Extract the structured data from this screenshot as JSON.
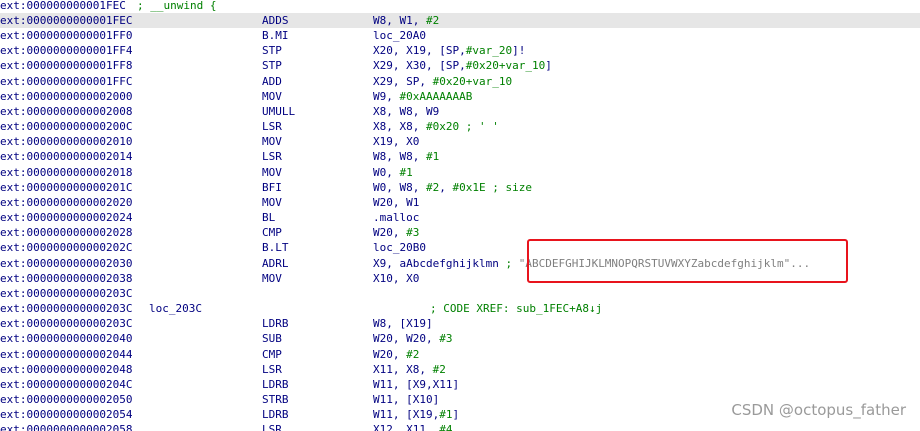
{
  "header": {
    "addr": "ext:000000000001FEC",
    "comment": "; __unwind {"
  },
  "rows": [
    {
      "addr": "ext:0000000000001FEC",
      "mn": "ADDS",
      "ops": [
        {
          "t": "W8, W1, "
        },
        {
          "t": "#2",
          "g": true
        }
      ],
      "selected": true
    },
    {
      "addr": "ext:0000000000001FF0",
      "mn": "B.MI",
      "ops": [
        {
          "t": "loc_20A0"
        }
      ]
    },
    {
      "addr": "ext:0000000000001FF4",
      "mn": "STP",
      "ops": [
        {
          "t": "X20, X19, [SP,"
        },
        {
          "t": "#var_20",
          "g": true
        },
        {
          "t": "]!"
        }
      ]
    },
    {
      "addr": "ext:0000000000001FF8",
      "mn": "STP",
      "ops": [
        {
          "t": "X29, X30, [SP,"
        },
        {
          "t": "#0x20+var_10",
          "g": true
        },
        {
          "t": "]"
        }
      ]
    },
    {
      "addr": "ext:0000000000001FFC",
      "mn": "ADD",
      "ops": [
        {
          "t": "X29, SP, "
        },
        {
          "t": "#0x20+var_10",
          "g": true
        }
      ]
    },
    {
      "addr": "ext:0000000000002000",
      "mn": "MOV",
      "ops": [
        {
          "t": "W9, "
        },
        {
          "t": "#0xAAAAAAAB",
          "g": true
        }
      ]
    },
    {
      "addr": "ext:0000000000002008",
      "mn": "UMULL",
      "ops": [
        {
          "t": "X8, W8, W9"
        }
      ]
    },
    {
      "addr": "ext:000000000000200C",
      "mn": "LSR",
      "ops": [
        {
          "t": "X8, X8, "
        },
        {
          "t": "#0x20",
          "g": true
        }
      ],
      "comment": "; ' '"
    },
    {
      "addr": "ext:0000000000002010",
      "mn": "MOV",
      "ops": [
        {
          "t": "X19, X0"
        }
      ]
    },
    {
      "addr": "ext:0000000000002014",
      "mn": "LSR",
      "ops": [
        {
          "t": "W8, W8, "
        },
        {
          "t": "#1",
          "g": true
        }
      ]
    },
    {
      "addr": "ext:0000000000002018",
      "mn": "MOV",
      "ops": [
        {
          "t": "W0, "
        },
        {
          "t": "#1",
          "g": true
        }
      ]
    },
    {
      "addr": "ext:000000000000201C",
      "mn": "BFI",
      "ops": [
        {
          "t": "W0, W8, "
        },
        {
          "t": "#2",
          "g": true
        },
        {
          "t": ", "
        },
        {
          "t": "#0x1E",
          "g": true
        }
      ],
      "comment": "; size"
    },
    {
      "addr": "ext:0000000000002020",
      "mn": "MOV",
      "ops": [
        {
          "t": "W20, W1"
        }
      ]
    },
    {
      "addr": "ext:0000000000002024",
      "mn": "BL",
      "ops": [
        {
          "t": ".malloc"
        }
      ]
    },
    {
      "addr": "ext:0000000000002028",
      "mn": "CMP",
      "ops": [
        {
          "t": "W20, "
        },
        {
          "t": "#3",
          "g": true
        }
      ]
    },
    {
      "addr": "ext:000000000000202C",
      "mn": "B.LT",
      "ops": [
        {
          "t": "loc_20B0"
        }
      ]
    },
    {
      "addr": "ext:0000000000002030",
      "mn": "ADRL",
      "ops": [
        {
          "t": "X9, aAbcdefghijklmn"
        }
      ],
      "comment": ";",
      "str": "\"ABCDEFGHIJKLMNOPQRSTUVWXYZabcdefghijklm\"..."
    },
    {
      "addr": "ext:0000000000002038",
      "mn": "MOV",
      "ops": [
        {
          "t": "X10, X0"
        }
      ]
    },
    {
      "addr": "ext:000000000000203C"
    },
    {
      "addr": "ext:000000000000203C",
      "label": "loc_203C",
      "xref": "; CODE XREF: sub_1FEC+A8↓j"
    },
    {
      "addr": "ext:000000000000203C",
      "mn": "LDRB",
      "ops": [
        {
          "t": "W8, [X19]"
        }
      ]
    },
    {
      "addr": "ext:0000000000002040",
      "mn": "SUB",
      "ops": [
        {
          "t": "W20, W20, "
        },
        {
          "t": "#3",
          "g": true
        }
      ]
    },
    {
      "addr": "ext:0000000000002044",
      "mn": "CMP",
      "ops": [
        {
          "t": "W20, "
        },
        {
          "t": "#2",
          "g": true
        }
      ]
    },
    {
      "addr": "ext:0000000000002048",
      "mn": "LSR",
      "ops": [
        {
          "t": "X11, X8, "
        },
        {
          "t": "#2",
          "g": true
        }
      ]
    },
    {
      "addr": "ext:000000000000204C",
      "mn": "LDRB",
      "ops": [
        {
          "t": "W11, [X9,X11]"
        }
      ]
    },
    {
      "addr": "ext:0000000000002050",
      "mn": "STRB",
      "ops": [
        {
          "t": "W11, [X10]"
        }
      ]
    },
    {
      "addr": "ext:0000000000002054",
      "mn": "LDRB",
      "ops": [
        {
          "t": "W11, [X19,"
        },
        {
          "t": "#1",
          "g": true
        },
        {
          "t": "]"
        }
      ]
    },
    {
      "addr": "ext:0000000000002058",
      "mn": "LSR",
      "ops": [
        {
          "t": "X12, X11, "
        },
        {
          "t": "#4",
          "g": true
        }
      ]
    }
  ],
  "watermark": "CSDN @octopus_father",
  "colors": {
    "address": "#000080",
    "immediate": "#008000",
    "comment": "#008000",
    "string": "#7f7f7f",
    "highlight": "#e8141d",
    "selection": "#e6e6e6"
  }
}
